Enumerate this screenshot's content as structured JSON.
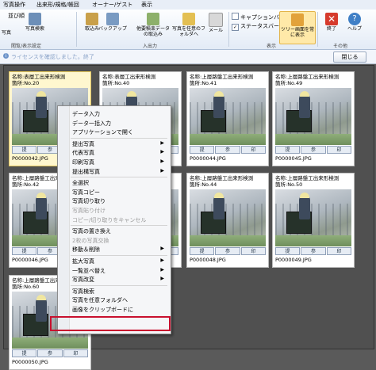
{
  "tabs": [
    "写真操作",
    "出来形/規格/帳回",
    "オーナー/ゲスト",
    "表示"
  ],
  "ribbon": {
    "sort_label": "並び順",
    "left_partial": "写真",
    "buttons": [
      {
        "label": "写真検索",
        "icon": "search-photo-icon"
      },
      {
        "label": "取込み",
        "icon": "import-icon"
      },
      {
        "label": "バックアップ",
        "icon": "backup-icon"
      },
      {
        "label": "他要積束データの取込み",
        "icon": "import-data-icon"
      },
      {
        "label": "写真を任意のフォルダへ",
        "icon": "folder-export-icon"
      },
      {
        "label": "メール",
        "icon": "mail-icon"
      },
      {
        "label": "ツリー画面を常に表示",
        "icon": "pin-tree-icon"
      },
      {
        "label": "終了",
        "icon": "exit-icon"
      },
      {
        "label": "ヘルプ",
        "icon": "help-icon"
      }
    ],
    "checkboxes": [
      {
        "label": "キャプションバー",
        "checked": false
      },
      {
        "label": "ステータスバー",
        "checked": true
      }
    ],
    "groups": [
      "閲覧/表示設定",
      "入出力",
      "表示",
      "その他"
    ]
  },
  "info": {
    "text": "ライセンスを確認しました。終了",
    "close_label": "閉じる"
  },
  "cards": [
    {
      "name": "名称:表層工出来形検測",
      "loc": "箇所:No.20",
      "file": "P0000042.JPG"
    },
    {
      "name": "名称:表層工出来形検測",
      "loc": "箇所:No.40",
      "file": "P0000043.JPG"
    },
    {
      "name": "名称:上層路盤工出来形検測",
      "loc": "箇所:No.41",
      "file": "P0000044.JPG"
    },
    {
      "name": "名称:上層路盤工出来形検測",
      "loc": "箇所:No.49",
      "file": "P0000045.JPG"
    },
    {
      "name": "名称:上層路盤工出来形検測",
      "loc": "箇所:No.42",
      "file": "P0000046.JPG"
    },
    {
      "name": "名称:上層路盤工出来形検測",
      "loc": "箇所:No.43",
      "file": "P0000047.JPG"
    },
    {
      "name": "名称:上層路盤工出来形検測",
      "loc": "箇所:No.44",
      "file": "P0000048.JPG"
    },
    {
      "name": "名称:上層路盤工出来形検測",
      "loc": "箇所:No.50",
      "file": "P0000049.JPG"
    },
    {
      "name": "名称:上層路盤工出来形検測",
      "loc": "箇所:No.60",
      "file": "P0000050.JPG"
    }
  ],
  "card_icons": [
    "提",
    "参",
    "印"
  ],
  "menu": [
    {
      "label": "データ入力"
    },
    {
      "label": "データ一括入力"
    },
    {
      "label": "アプリケーションで開く"
    },
    {
      "sep": true
    },
    {
      "label": "提出写真",
      "sub": true
    },
    {
      "label": "代表写真",
      "sub": true
    },
    {
      "label": "印刷写真",
      "sub": true
    },
    {
      "label": "提出構写真",
      "sub": true
    },
    {
      "sep": true
    },
    {
      "label": "全選択"
    },
    {
      "label": "写真コピー"
    },
    {
      "label": "写真切り取り"
    },
    {
      "label": "写真貼り付け",
      "disabled": true
    },
    {
      "label": "コピー/切り取りをキャンセル",
      "disabled": true
    },
    {
      "sep": true
    },
    {
      "label": "写真の置き換え"
    },
    {
      "label": "2枚の写真交換",
      "disabled": true
    },
    {
      "label": "移動＆削除",
      "sub": true
    },
    {
      "sep": true
    },
    {
      "label": "拡大写真",
      "sub": true
    },
    {
      "label": "一覧並べ替え",
      "sub": true
    },
    {
      "label": "写真改変",
      "sub": true
    },
    {
      "sep": true
    },
    {
      "label": "写真検索"
    },
    {
      "label": "写真を任意フォルダへ"
    },
    {
      "label": "画像をクリップボードに"
    }
  ]
}
